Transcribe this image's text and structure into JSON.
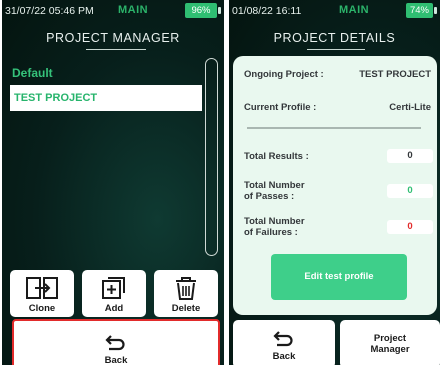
{
  "left_screen": {
    "status": {
      "time": "31/07/22 05:46 PM",
      "mode": "MAIN",
      "battery": "96%"
    },
    "title": "PROJECT MANAGER",
    "list": {
      "group": "Default",
      "items": [
        "TEST PROJECT"
      ]
    },
    "actions": {
      "clone": "Clone",
      "add": "Add",
      "delete": "Delete",
      "back": "Back"
    }
  },
  "right_screen": {
    "status": {
      "time": "01/08/22 16:11",
      "mode": "MAIN",
      "battery": "74%"
    },
    "title": "PROJECT DETAILS",
    "ongoing_project_label": "Ongoing Project :",
    "ongoing_project_value": "TEST PROJECT",
    "current_profile_label": "Current Profile :",
    "current_profile_value": "Certi-Lite",
    "total_results_label": "Total Results :",
    "total_results_value": "0",
    "passes_label_1": "Total Number",
    "passes_label_2": "of Passes :",
    "passes_value": "0",
    "failures_label_1": "Total Number",
    "failures_label_2": "of Failures :",
    "failures_value": "0",
    "edit_profile_button": "Edit test profile",
    "back": "Back",
    "project_manager_1": "Project",
    "project_manager_2": "Manager"
  },
  "colors": {
    "accent_green": "#2bb36a",
    "pass_green": "#2fbe72",
    "fail_red": "#e22b2b"
  },
  "icons": [
    "clone-icon",
    "add-icon",
    "delete-icon",
    "back-arrow-icon"
  ]
}
